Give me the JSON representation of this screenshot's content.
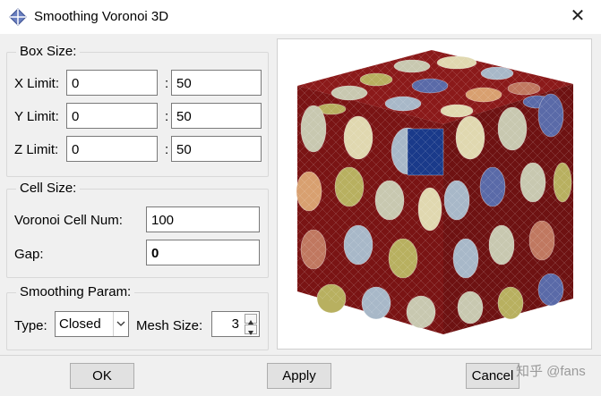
{
  "window": {
    "title": "Smoothing Voronoi 3D",
    "close_glyph": "✕",
    "icon": "app-diamond-icon"
  },
  "box_size": {
    "title": "Box Size:",
    "colon": ":",
    "x": {
      "label": "X Limit:",
      "min": "0",
      "max": "50"
    },
    "y": {
      "label": "Y Limit:",
      "min": "0",
      "max": "50"
    },
    "z": {
      "label": "Z Limit:",
      "min": "0",
      "max": "50"
    }
  },
  "cell_size": {
    "title": "Cell Size:",
    "num_label": "Voronoi Cell Num:",
    "num_value": "100",
    "gap_label": "Gap:",
    "gap_value": "0"
  },
  "smoothing": {
    "title": "Smoothing Param:",
    "type_label": "Type:",
    "type_value": "Closed",
    "mesh_label": "Mesh Size:",
    "mesh_value": "3"
  },
  "preview": {
    "description_icon": "voronoi-cube-preview",
    "colors": {
      "matrix": "#8b1a1a",
      "cells": [
        "#c8c8b0",
        "#a8b8c8",
        "#d8a070",
        "#b8b060",
        "#5a6aa8",
        "#c07860",
        "#1a3a8a",
        "#e0d8b0"
      ]
    }
  },
  "buttons": {
    "ok": "OK",
    "apply": "Apply",
    "cancel": "Cancel"
  },
  "watermark": "知乎 @fans"
}
